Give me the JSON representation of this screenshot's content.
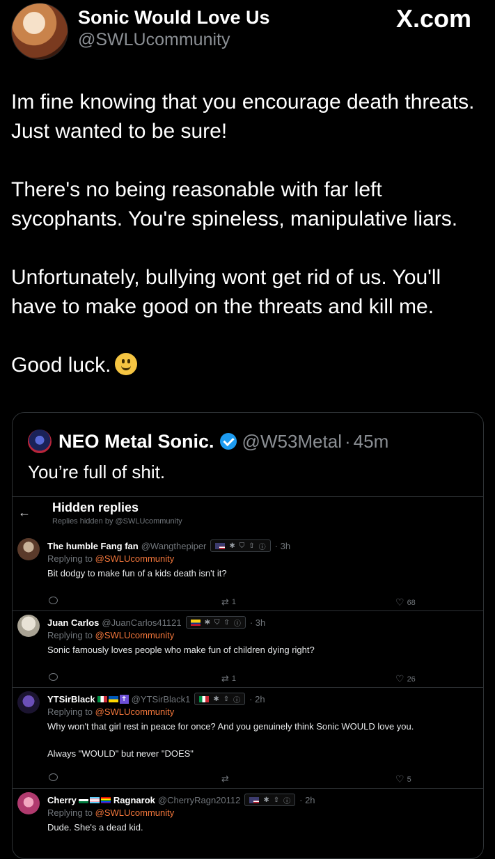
{
  "header": {
    "display_name": "Sonic Would Love Us",
    "handle": "@SWLUcommunity",
    "brand": "X.com"
  },
  "tweet": {
    "paragraphs": [
      "Im fine knowing that you encourage death threats. Just wanted to be sure!",
      "There's no being reasonable with far left sycophants. You're spineless, manipulative liars.",
      "Unfortunately, bullying wont get rid of us. You'll have to make good on the threats and kill me.",
      "Good luck."
    ]
  },
  "quote": {
    "name": "NEO Metal Sonic.",
    "handle": "@W53Metal",
    "sep": "·",
    "time": "45m",
    "text": "You’re full of shit.",
    "hidden": {
      "back": "←",
      "title": "Hidden replies",
      "subtitle": "Replies hidden by @SWLUcommunity"
    },
    "replies": [
      {
        "name": "The humble Fang fan",
        "handle": "@Wangthepiper",
        "time": "· 3h",
        "replying_prefix": "Replying to ",
        "replying_to": "@SWLUcommunity",
        "text": "Bit dodgy to make fun of a kids death isn't it?",
        "text2": "",
        "retweets": "1",
        "likes": "68"
      },
      {
        "name": "Juan Carlos",
        "handle": "@JuanCarlos41121",
        "time": "· 3h",
        "replying_prefix": "Replying to ",
        "replying_to": "@SWLUcommunity",
        "text": "Sonic famously loves people who make fun of children dying right?",
        "text2": "",
        "retweets": "1",
        "likes": "26"
      },
      {
        "name": "YTSirBlack",
        "handle": "@YTSirBlack1",
        "time": "· 2h",
        "replying_prefix": "Replying to ",
        "replying_to": "@SWLUcommunity",
        "text": "Why won't that girl rest in peace for once? And you genuinely think Sonic WOULD love you.",
        "text2": "Always \"WOULD\" but never \"DOES\"",
        "retweets": "",
        "likes": "5"
      },
      {
        "name": "Cherry",
        "name_suffix": "Ragnarok",
        "handle": "@CherryRagn20112",
        "time": "· 2h",
        "replying_prefix": "Replying to ",
        "replying_to": "@SWLUcommunity",
        "text": "Dude. She's a dead kid.",
        "text2": "",
        "retweets": "",
        "likes": ""
      }
    ]
  },
  "colors": {
    "background": "#000000",
    "mention": "#f4773b",
    "verified": "#1d9bf0",
    "muted": "#71767b"
  }
}
